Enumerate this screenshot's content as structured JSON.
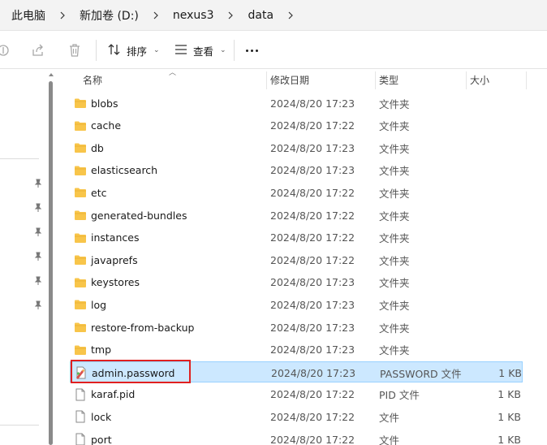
{
  "breadcrumb": {
    "items": [
      "此电脑",
      "新加卷 (D:)",
      "nexus3",
      "data"
    ],
    "separator_icon": "chevron-right-icon"
  },
  "toolbar": {
    "sort_label": "排序",
    "view_label": "查看",
    "icons": [
      "cut-icon",
      "share-icon",
      "delete-icon",
      "sort-icon",
      "view-icon",
      "more-icon"
    ]
  },
  "columns": {
    "name": "名称",
    "date": "修改日期",
    "type": "类型",
    "size": "大小"
  },
  "files": [
    {
      "name": "blobs",
      "date": "2024/8/20 17:23",
      "type": "文件夹",
      "size": "",
      "icon": "folder-icon"
    },
    {
      "name": "cache",
      "date": "2024/8/20 17:22",
      "type": "文件夹",
      "size": "",
      "icon": "folder-icon"
    },
    {
      "name": "db",
      "date": "2024/8/20 17:23",
      "type": "文件夹",
      "size": "",
      "icon": "folder-icon"
    },
    {
      "name": "elasticsearch",
      "date": "2024/8/20 17:23",
      "type": "文件夹",
      "size": "",
      "icon": "folder-icon"
    },
    {
      "name": "etc",
      "date": "2024/8/20 17:22",
      "type": "文件夹",
      "size": "",
      "icon": "folder-icon"
    },
    {
      "name": "generated-bundles",
      "date": "2024/8/20 17:22",
      "type": "文件夹",
      "size": "",
      "icon": "folder-icon"
    },
    {
      "name": "instances",
      "date": "2024/8/20 17:22",
      "type": "文件夹",
      "size": "",
      "icon": "folder-icon"
    },
    {
      "name": "javaprefs",
      "date": "2024/8/20 17:22",
      "type": "文件夹",
      "size": "",
      "icon": "folder-icon"
    },
    {
      "name": "keystores",
      "date": "2024/8/20 17:23",
      "type": "文件夹",
      "size": "",
      "icon": "folder-icon"
    },
    {
      "name": "log",
      "date": "2024/8/20 17:23",
      "type": "文件夹",
      "size": "",
      "icon": "folder-icon"
    },
    {
      "name": "restore-from-backup",
      "date": "2024/8/20 17:23",
      "type": "文件夹",
      "size": "",
      "icon": "folder-icon"
    },
    {
      "name": "tmp",
      "date": "2024/8/20 17:23",
      "type": "文件夹",
      "size": "",
      "icon": "folder-icon"
    },
    {
      "name": "admin.password",
      "date": "2024/8/20 17:23",
      "type": "PASSWORD 文件",
      "size": "1 KB",
      "icon": "password-file-icon",
      "selected": true
    },
    {
      "name": "karaf.pid",
      "date": "2024/8/20 17:22",
      "type": "PID 文件",
      "size": "1 KB",
      "icon": "file-icon"
    },
    {
      "name": "lock",
      "date": "2024/8/20 17:22",
      "type": "文件",
      "size": "1 KB",
      "icon": "file-icon"
    },
    {
      "name": "port",
      "date": "2024/8/20 17:22",
      "type": "文件",
      "size": "1 KB",
      "icon": "file-icon"
    }
  ],
  "colors": {
    "folder": "#f8c54a",
    "selection": "#cce8ff",
    "highlight": "#e02020"
  }
}
